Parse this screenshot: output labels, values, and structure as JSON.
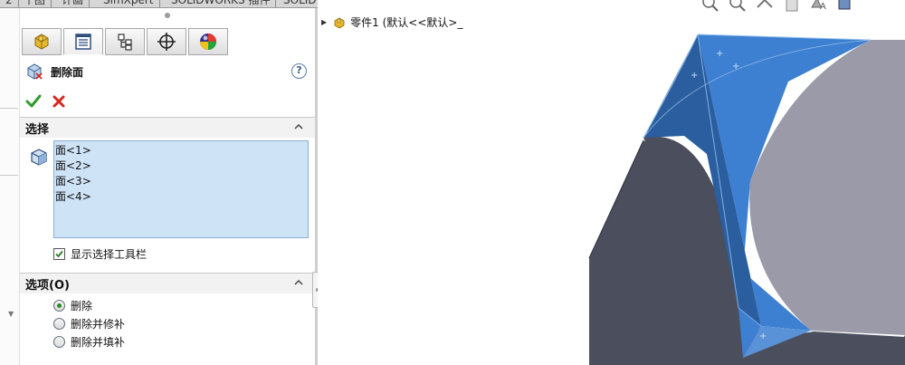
{
  "top_tabs": [
    "2",
    "十图",
    "计画",
    "SimXpert",
    "SOLIDWORKS 插件",
    "SOLIDWORKS MBD"
  ],
  "property_manager": {
    "tabs": [
      {
        "name": "feature-manager-tab",
        "icon": "part-icon"
      },
      {
        "name": "property-manager-tab",
        "icon": "property-list-icon"
      },
      {
        "name": "configuration-manager-tab",
        "icon": "configuration-icon"
      },
      {
        "name": "dimxpert-tab",
        "icon": "crosshair-icon"
      },
      {
        "name": "display-manager-tab",
        "icon": "color-sphere-icon"
      }
    ],
    "feature_title": "删除面",
    "help_label": "?",
    "selection_group": {
      "title": "选择",
      "faces": [
        "面<1>",
        "面<2>",
        "面<3>",
        "面<4>"
      ],
      "show_toolbar_label": "显示选择工具栏",
      "show_toolbar_checked": true
    },
    "options_group": {
      "title": "选项(O)",
      "options": [
        {
          "label": "删除",
          "selected": true
        },
        {
          "label": "删除并修补",
          "selected": false
        },
        {
          "label": "删除并填补",
          "selected": false
        }
      ]
    }
  },
  "graphics": {
    "tree_root": "零件1  (默认<<默认>_"
  },
  "colors": {
    "accent_blue": "#3d7fd1",
    "face_dark": "#4b4e5c",
    "face_light": "#9a9aa8",
    "selection_bg": "#cfe3f7"
  }
}
